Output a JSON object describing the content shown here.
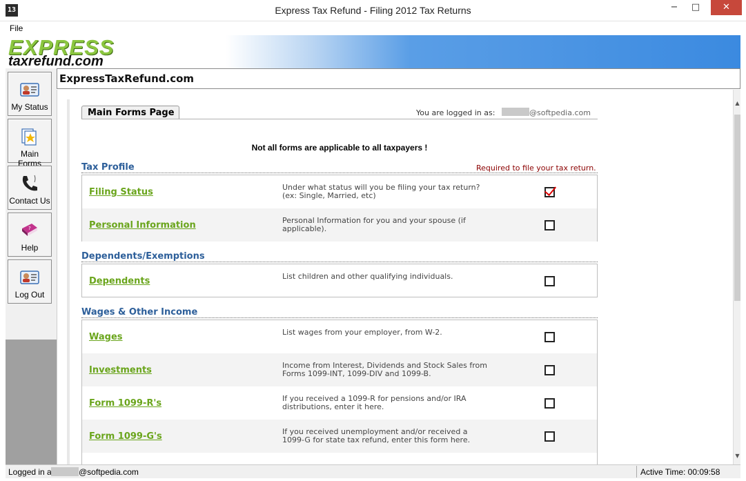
{
  "window": {
    "title": "Express Tax Refund - Filing 2012 Tax Returns",
    "icon_text": "13",
    "minimize": "−",
    "maximize": "□",
    "close": "✕"
  },
  "menu": {
    "file": "File"
  },
  "banner": {
    "logo_top": "EXPRESS",
    "logo_bottom": "taxrefund.com"
  },
  "header": {
    "title": "ExpressTaxRefund.com"
  },
  "sidebar": {
    "items": [
      {
        "label": "My Status",
        "icon": "id-card-icon"
      },
      {
        "label": "Main Forms",
        "icon": "forms-icon"
      },
      {
        "label": "Contact Us",
        "icon": "phone-icon"
      },
      {
        "label": "Help",
        "icon": "help-book-icon"
      },
      {
        "label": "Log Out",
        "icon": "id-card-icon"
      }
    ]
  },
  "page": {
    "tab": "Main Forms Page",
    "logged_in_label": "You are logged in as:",
    "logged_in_email": "@softpedia.com",
    "notice": "Not all forms are applicable to all taxpayers !",
    "required_note": "Required to file your tax return."
  },
  "sections": [
    {
      "title": "Tax Profile",
      "rows": [
        {
          "link": "Filing Status",
          "desc": "Under what status will you be filing your tax return? (ex: Single, Married, etc)",
          "checked": true
        },
        {
          "link": "Personal Information",
          "desc": "Personal Information for you and your spouse (if applicable).",
          "checked": false
        }
      ]
    },
    {
      "title": "Dependents/Exemptions",
      "rows": [
        {
          "link": "Dependents",
          "desc": "List children and other qualifying individuals.",
          "checked": false
        }
      ]
    },
    {
      "title": "Wages & Other Income",
      "rows": [
        {
          "link": "Wages",
          "desc": "List wages from your employer, from W-2.",
          "checked": false
        },
        {
          "link": "Investments",
          "desc": "Income from Interest, Dividends and Stock Sales from Forms 1099-INT, 1099-DIV and 1099-B.",
          "checked": false
        },
        {
          "link": "Form 1099-R's",
          "desc": "If you received a 1099-R for pensions and/or IRA distributions, enter it here.",
          "checked": false
        },
        {
          "link": "Form 1099-G's",
          "desc": "If you received unemployment and/or received a 1099-G for state tax refund, enter this form here.",
          "checked": false
        }
      ]
    }
  ],
  "status": {
    "logged_in": "Logged in as",
    "email": "@softpedia.com",
    "active_time": "Active Time: 00:09:58"
  },
  "colors": {
    "link_green": "#6aa51c",
    "section_blue": "#2d5f9a",
    "required_red": "#8b0000"
  }
}
